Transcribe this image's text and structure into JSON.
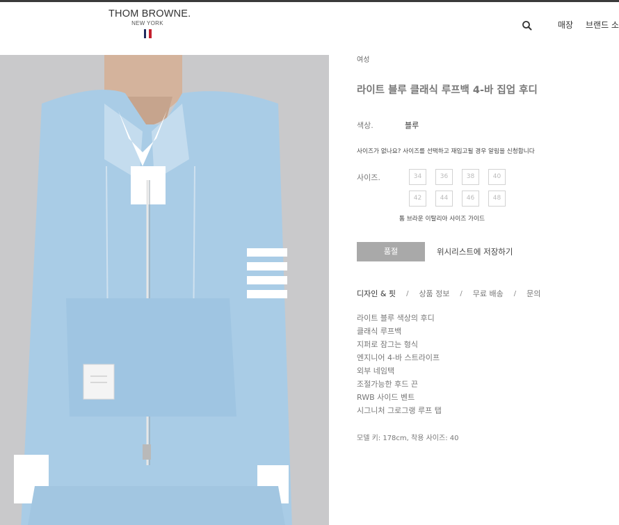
{
  "header": {
    "logo": {
      "main": "THOM BROWNE.",
      "sub": "NEW YORK"
    },
    "flag_colors": [
      "#1f2a5e",
      "#ffffff",
      "#c4202e"
    ],
    "search_icon": "search-icon",
    "nav": {
      "stores": "매장",
      "brand": "브랜드 소"
    }
  },
  "product": {
    "breadcrumb": "여성",
    "title": "라이트 블루 클래식 루프백 4-바 집업 후디",
    "color_label": "색상.",
    "color_value": "블루",
    "restock_note": "사이즈가 없나요? 사이즈를 선택하고 재입고될 경우 알림을 신청합니다",
    "size_label": "사이즈.",
    "sizes": [
      "34",
      "36",
      "38",
      "40",
      "42",
      "44",
      "46",
      "48"
    ],
    "size_guide": "톰 브라운 이탈리아 사이즈 가이드",
    "soldout_label": "품절",
    "wishlist_label": "위시리스트에 저장하기"
  },
  "tabs": [
    "디자인 & 핏",
    "상품 정보",
    "무료 배송",
    "문의"
  ],
  "tab_separator": "/",
  "features": [
    "라이트 블루 색상의 후디",
    "클래식 루프백",
    "지퍼로 잠그는 형식",
    "엔지니어 4-바 스트라이프",
    "외부 네임택",
    "조절가능한 후드 끈",
    "RWB 사이드 벤트",
    "시그니처 그로그랭 루프 탭"
  ],
  "model_info": "모델 키: 178cm, 착용 사이즈: 40",
  "colors": {
    "hoodie": "#a9cce6",
    "soldout_bg": "#a9a9a9",
    "photo_bg": "#c9c9cb"
  }
}
